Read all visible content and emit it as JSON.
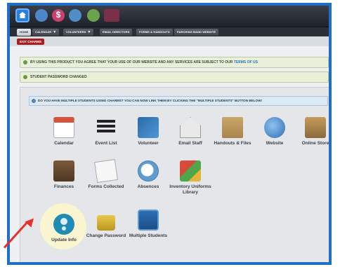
{
  "tabs": [
    {
      "label": "HOME",
      "active": true
    },
    {
      "label": "CALENDAR",
      "caret": "▼"
    },
    {
      "label": "VOLUNTEERS",
      "caret": "▼"
    },
    {
      "label": "EMAIL DIRECTORS"
    },
    {
      "label": "FORMS & HANDOUTS"
    },
    {
      "label": "PARCHING BAND WEBSITE"
    }
  ],
  "exit_button": "EXIT CHARMS",
  "notices": {
    "terms": "BY USING THIS PRODUCT YOU AGREE THAT YOUR USE OF OUR WEBSITE AND ANY SERVICES ARE SUBJECT TO OUR",
    "terms_link": "TERMS OF US",
    "password": "STUDENT PASSWORD CHANGED",
    "multiple": "DO YOU HAVE MULTIPLE STUDENTS USING CHARMS? YOU CAN NOW LINK THEM BY CLICKING THE \"MULTIPLE STUDENTS\" BUTTON BELOW!"
  },
  "tiles": [
    {
      "label": "Calendar",
      "icon": "calendar-icon"
    },
    {
      "label": "Event List",
      "icon": "event-list-icon"
    },
    {
      "label": "Volunteer",
      "icon": "volunteer-icon"
    },
    {
      "label": "Email Staff",
      "icon": "email-staff-icon"
    },
    {
      "label": "Handouts & Files",
      "icon": "handouts-files-icon"
    },
    {
      "label": "Website",
      "icon": "website-icon"
    },
    {
      "label": "Online Store",
      "icon": "online-store-icon"
    },
    {
      "label": "Finances",
      "icon": "finances-icon"
    },
    {
      "label": "Forms Collected",
      "icon": "forms-collected-icon"
    },
    {
      "label": "Absences",
      "icon": "absences-icon"
    },
    {
      "label": "Inventory Uniforms Library",
      "icon": "inventory-icon"
    },
    {
      "label": "Update Info",
      "icon": "update-info-icon"
    },
    {
      "label": "Change Password",
      "icon": "change-password-icon"
    },
    {
      "label": "Multiple Students",
      "icon": "multiple-students-icon"
    }
  ],
  "colors": {
    "frame": "#1f6fc6",
    "exit_button": "#a81f23",
    "highlight": "#faf6cd",
    "arrow": "#e4322b"
  }
}
